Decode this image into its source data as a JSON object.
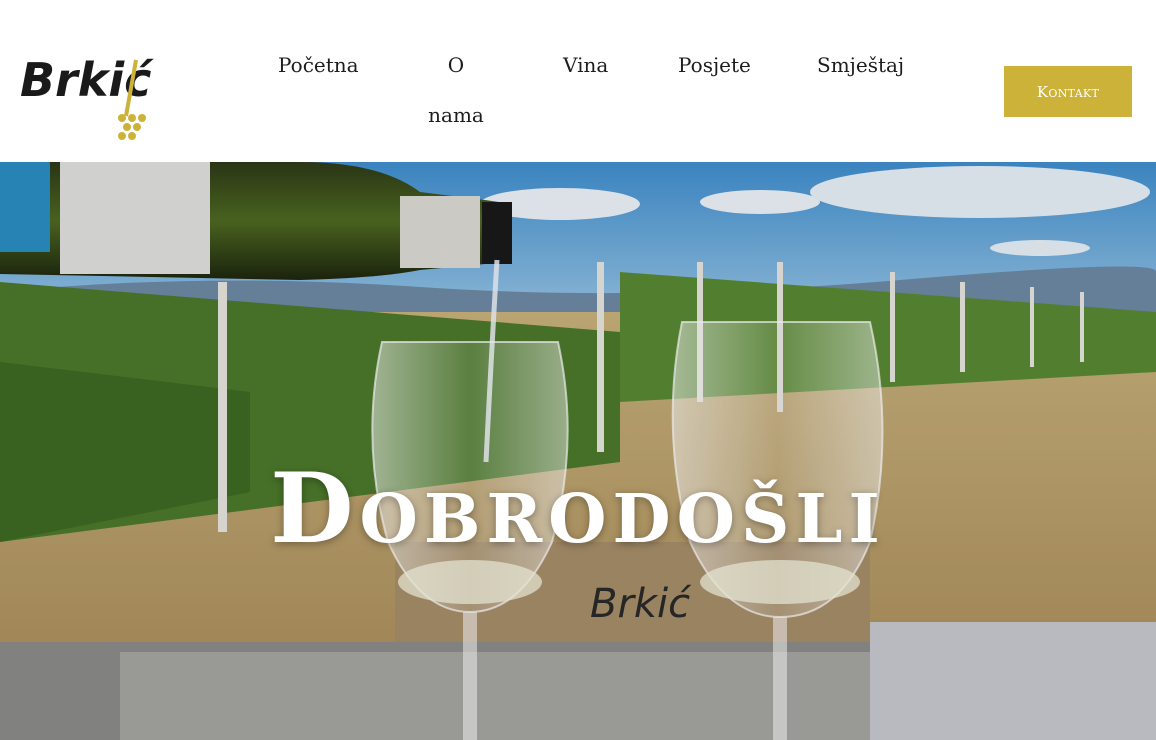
{
  "brand": {
    "logo_text": "Brkić",
    "accent_color": "#cdb23a"
  },
  "nav": {
    "items": [
      {
        "label": "Početna"
      },
      {
        "label": "O nama"
      },
      {
        "label": "Vina"
      },
      {
        "label": "Posjete"
      },
      {
        "label": "Smještaj"
      }
    ],
    "cta_label": "Kontakt"
  },
  "hero": {
    "title": "Dobrodošli",
    "crate_text": "Brkić"
  }
}
